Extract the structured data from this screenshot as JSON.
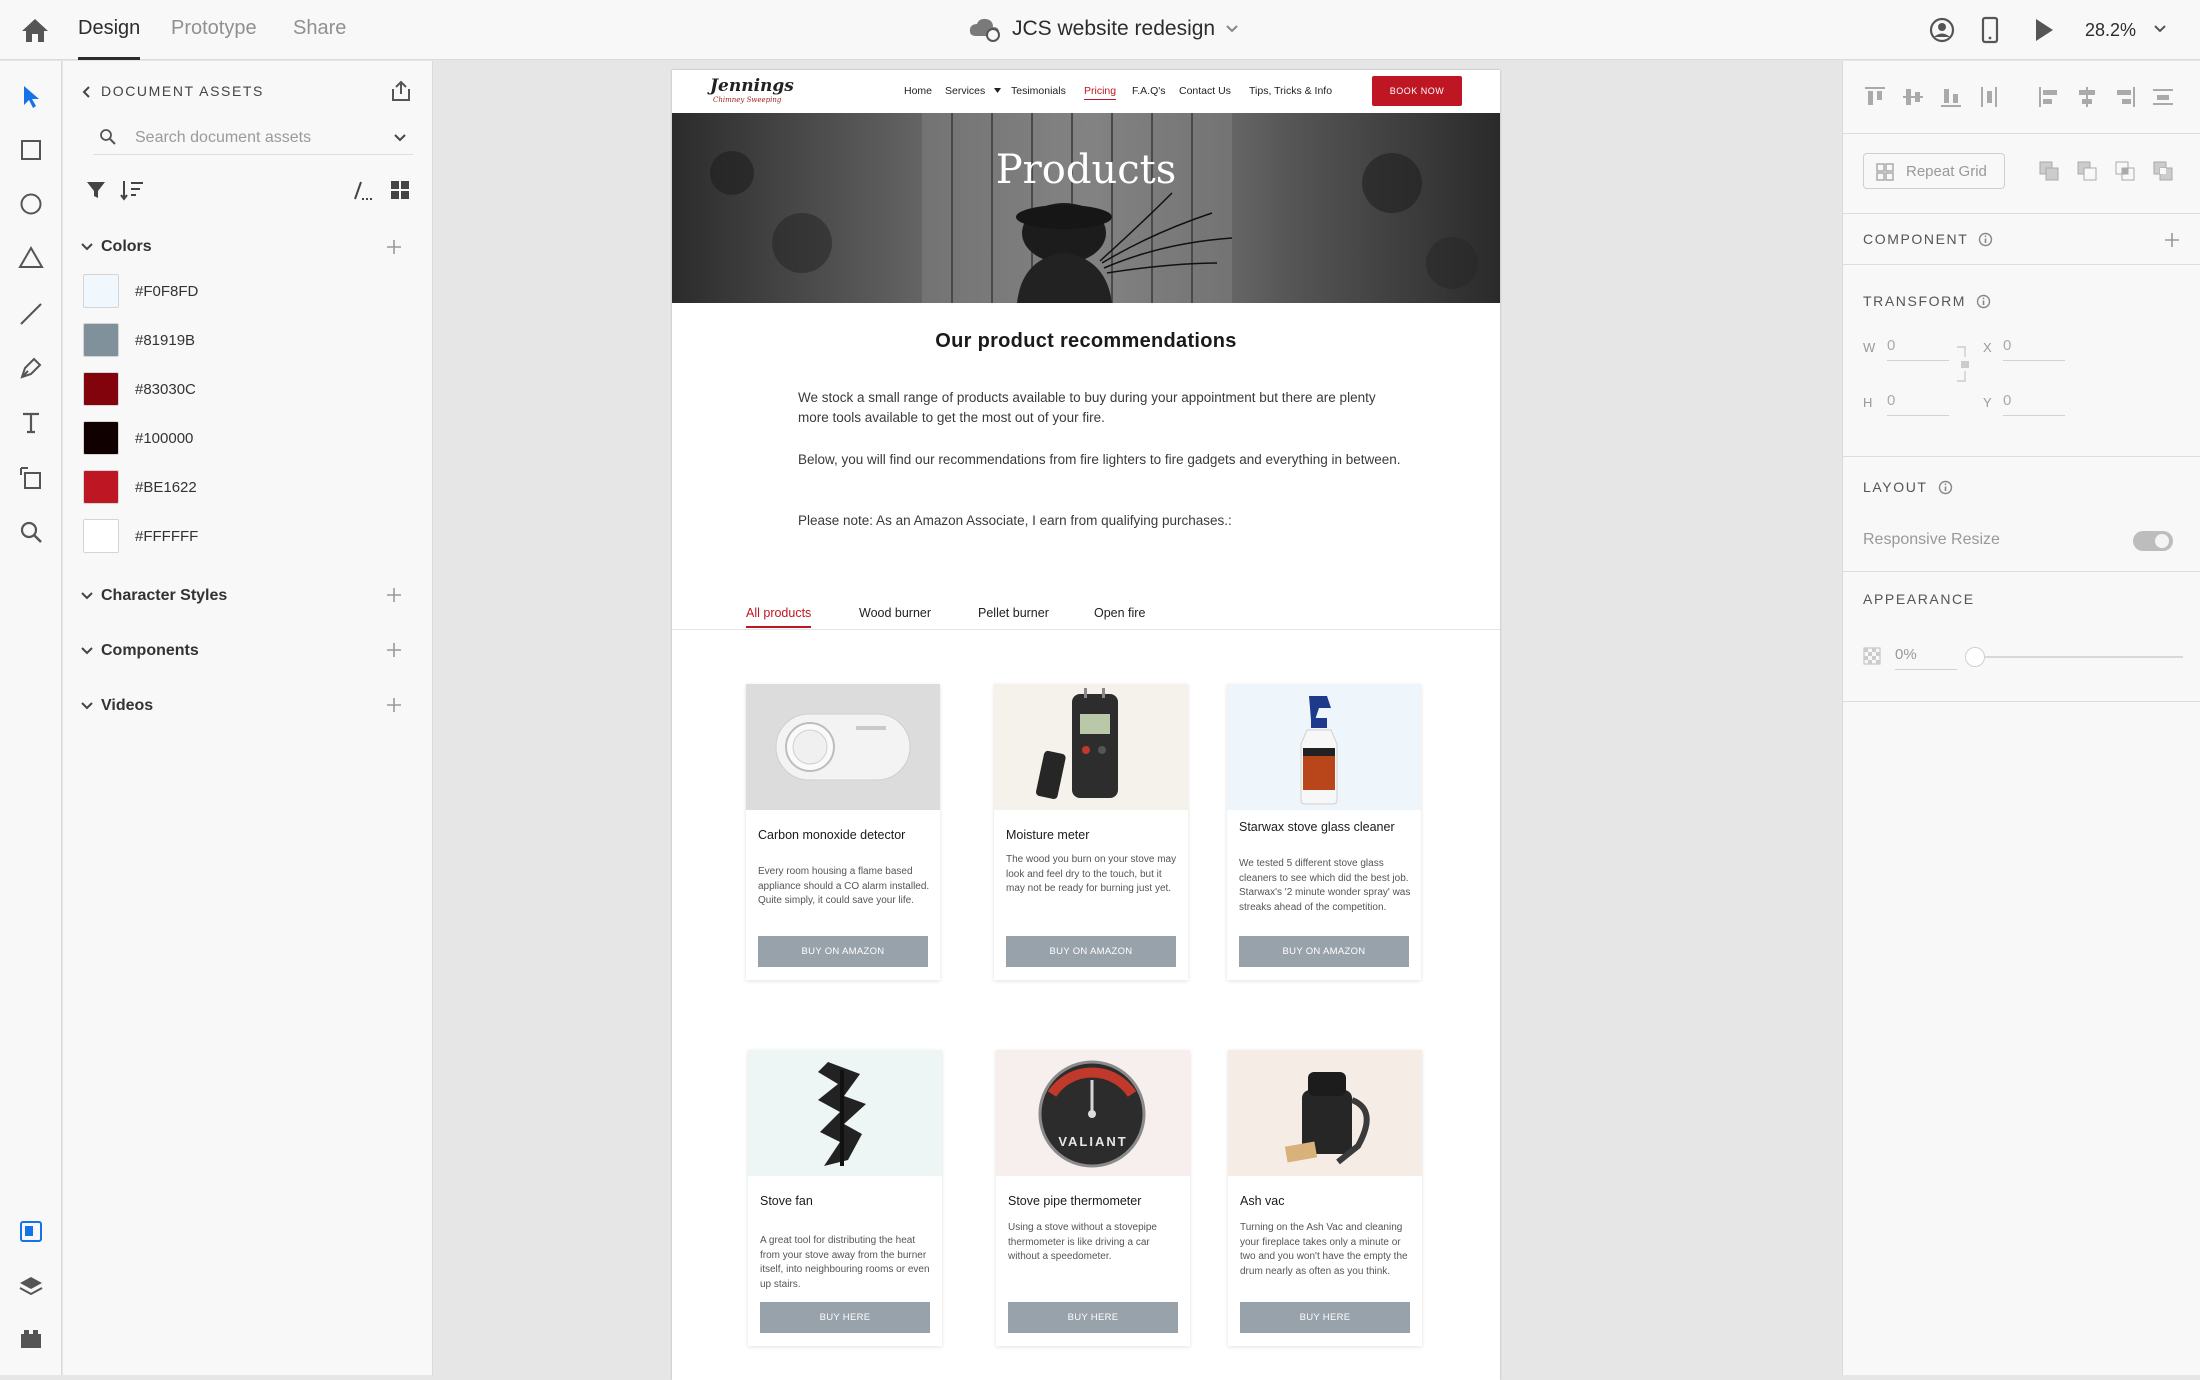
{
  "topbar": {
    "modes": [
      {
        "label": "Design"
      },
      {
        "label": "Prototype"
      },
      {
        "label": "Share"
      }
    ],
    "document_title": "JCS website redesign",
    "zoom": "28.2%"
  },
  "assets": {
    "title": "DOCUMENT ASSETS",
    "search_placeholder": "Search document assets",
    "sections": {
      "colors": "Colors",
      "character_styles": "Character Styles",
      "components": "Components",
      "videos": "Videos"
    },
    "colors": [
      {
        "hex": "#F0F8FD"
      },
      {
        "hex": "#81919B"
      },
      {
        "hex": "#83030C"
      },
      {
        "hex": "#100000"
      },
      {
        "hex": "#BE1622"
      },
      {
        "hex": "#FFFFFF"
      }
    ]
  },
  "site": {
    "logo": "Jennings",
    "logo_sub": "Chimney Sweeping",
    "nav": [
      "Home",
      "Services",
      "Tesimonials",
      "Pricing",
      "F.A.Q's",
      "Contact Us",
      "Tips, Tricks & Info"
    ],
    "book_now": "BOOK NOW",
    "hero_title": "Products",
    "section_title": "Our product recommendations",
    "paragraphs": [
      "We stock a small range of products available to buy during your appointment but there are plenty more tools available to get the most out of your fire.",
      "Below, you will find our recommendations from fire lighters to fire gadgets and everything in between.",
      "Please note: As an Amazon Associate, I earn from qualifying purchases.:"
    ],
    "tabs": [
      "All products",
      "Wood burner",
      "Pellet burner",
      "Open fire"
    ],
    "products": [
      {
        "title": "Carbon monoxide detector",
        "desc": "Every room housing a flame based appliance should a CO alarm installed. Quite simply, it could save your life.",
        "button": "BUY ON AMAZON"
      },
      {
        "title": "Moisture meter",
        "desc": "The wood you burn on your stove may look and feel dry to the touch, but it may not be ready for burning just yet.",
        "button": "BUY ON AMAZON"
      },
      {
        "title": "Starwax stove glass cleaner",
        "desc": "We tested 5 different stove glass cleaners to see which did the best job. Starwax's '2 minute wonder spray' was streaks ahead of the competition.",
        "button": "BUY ON AMAZON"
      },
      {
        "title": "Stove fan",
        "desc": "A great tool for distributing the heat from your stove away from the burner itself, into neighbouring rooms or even up stairs.",
        "button": "BUY HERE"
      },
      {
        "title": "Stove pipe thermometer",
        "desc": "Using a stove without a stovepipe thermometer is like driving a car without a speedometer.",
        "button": "BUY HERE"
      },
      {
        "title": "Ash vac",
        "desc": "Turning on the Ash Vac and cleaning your fireplace takes only a minute or two and you won't have the empty the drum nearly as often as you think.",
        "button": "BUY HERE"
      }
    ],
    "thermometer_brand": "VALIANT"
  },
  "props": {
    "repeat_grid": "Repeat Grid",
    "component": "COMPONENT",
    "transform": "TRANSFORM",
    "w_label": "W",
    "w_value": "0",
    "x_label": "X",
    "x_value": "0",
    "h_label": "H",
    "h_value": "0",
    "y_label": "Y",
    "y_value": "0",
    "layout": "LAYOUT",
    "responsive_resize": "Responsive Resize",
    "appearance": "APPEARANCE",
    "opacity": "0%"
  }
}
